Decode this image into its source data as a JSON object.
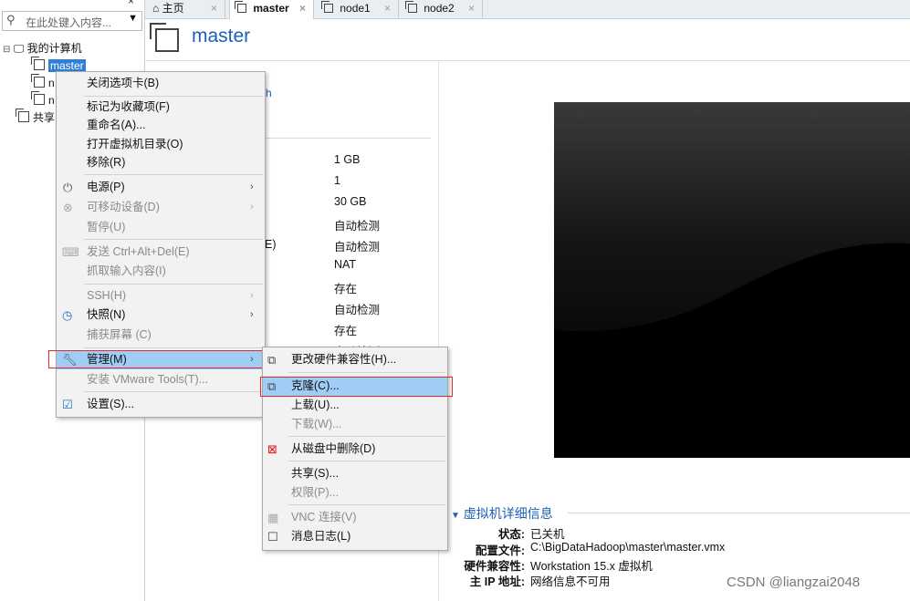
{
  "library": {
    "search_placeholder": "在此处键入内容...",
    "tree": {
      "root_label": "我的计算机",
      "vms": [
        "master",
        "n",
        "n"
      ],
      "shared_label": "共享"
    }
  },
  "tabs": [
    {
      "label": "主页",
      "icon": "home-icon"
    },
    {
      "label": "master",
      "icon": "vm-icon"
    },
    {
      "label": "node1",
      "icon": "vm-icon"
    },
    {
      "label": "node2",
      "icon": "vm-icon"
    }
  ],
  "vm": {
    "name": "master",
    "partial_label_1": "E)",
    "partial_label_2": "h",
    "hardware_values": [
      "1 GB",
      "1",
      "30 GB",
      "自动检测",
      "自动检测",
      "NAT",
      "存在",
      "自动检测",
      "存在",
      "自动检测"
    ]
  },
  "context_menu": {
    "items": [
      {
        "label": "关闭选项卡(B)",
        "disabled": false
      },
      {
        "label": "标记为收藏项(F)",
        "disabled": false
      },
      {
        "label": "重命名(A)...",
        "disabled": false
      },
      {
        "label": "打开虚拟机目录(O)",
        "disabled": false
      },
      {
        "label": "移除(R)",
        "disabled": false
      },
      {
        "label": "电源(P)",
        "disabled": false,
        "icon": "power-icon",
        "submenu": true
      },
      {
        "label": "可移动设备(D)",
        "disabled": true,
        "icon": "removable-device-icon",
        "submenu": true
      },
      {
        "label": "暂停(U)",
        "disabled": true
      },
      {
        "label": "发送 Ctrl+Alt+Del(E)",
        "disabled": true,
        "icon": "keyboard-icon"
      },
      {
        "label": "抓取输入内容(I)",
        "disabled": true
      },
      {
        "label": "SSH(H)",
        "disabled": true,
        "submenu": true
      },
      {
        "label": "快照(N)",
        "disabled": false,
        "icon": "snapshot-icon",
        "submenu": true
      },
      {
        "label": "捕获屏幕 (C)",
        "disabled": true
      },
      {
        "label": "管理(M)",
        "disabled": false,
        "icon": "wrench-icon",
        "submenu": true
      },
      {
        "label": "安装 VMware Tools(T)...",
        "disabled": true
      },
      {
        "label": "设置(S)...",
        "disabled": false,
        "icon": "settings-icon"
      }
    ]
  },
  "submenu": {
    "items": [
      {
        "label": "更改硬件兼容性(H)...",
        "disabled": false,
        "icon": "hardware-compat-icon"
      },
      {
        "label": "克隆(C)...",
        "disabled": false,
        "icon": "clone-icon",
        "highlighted": true
      },
      {
        "label": "上载(U)...",
        "disabled": false
      },
      {
        "label": "下载(W)...",
        "disabled": true
      },
      {
        "label": "从磁盘中删除(D)",
        "disabled": false,
        "icon": "delete-disk-icon"
      },
      {
        "label": "共享(S)...",
        "disabled": false
      },
      {
        "label": "权限(P)...",
        "disabled": true
      },
      {
        "label": "VNC 连接(V)",
        "disabled": true,
        "icon": "vnc-icon"
      },
      {
        "label": "消息日志(L)",
        "disabled": false,
        "icon": "log-icon"
      }
    ]
  },
  "details": {
    "heading": "虚拟机详细信息",
    "rows": [
      {
        "label": "状态:",
        "value": "已关机"
      },
      {
        "label": "配置文件:",
        "value": "C:\\BigDataHadoop\\master\\master.vmx"
      },
      {
        "label": "硬件兼容性:",
        "value": "Workstation 15.x 虚拟机"
      },
      {
        "label": "主 IP 地址:",
        "value": "网络信息不可用"
      }
    ]
  },
  "watermark": "CSDN @liangzai2048",
  "colors": {
    "accent": "#1c5fb8",
    "selection": "#2f7fd6",
    "highlight": "#9fcdf5",
    "annotation": "#e02a2a"
  }
}
